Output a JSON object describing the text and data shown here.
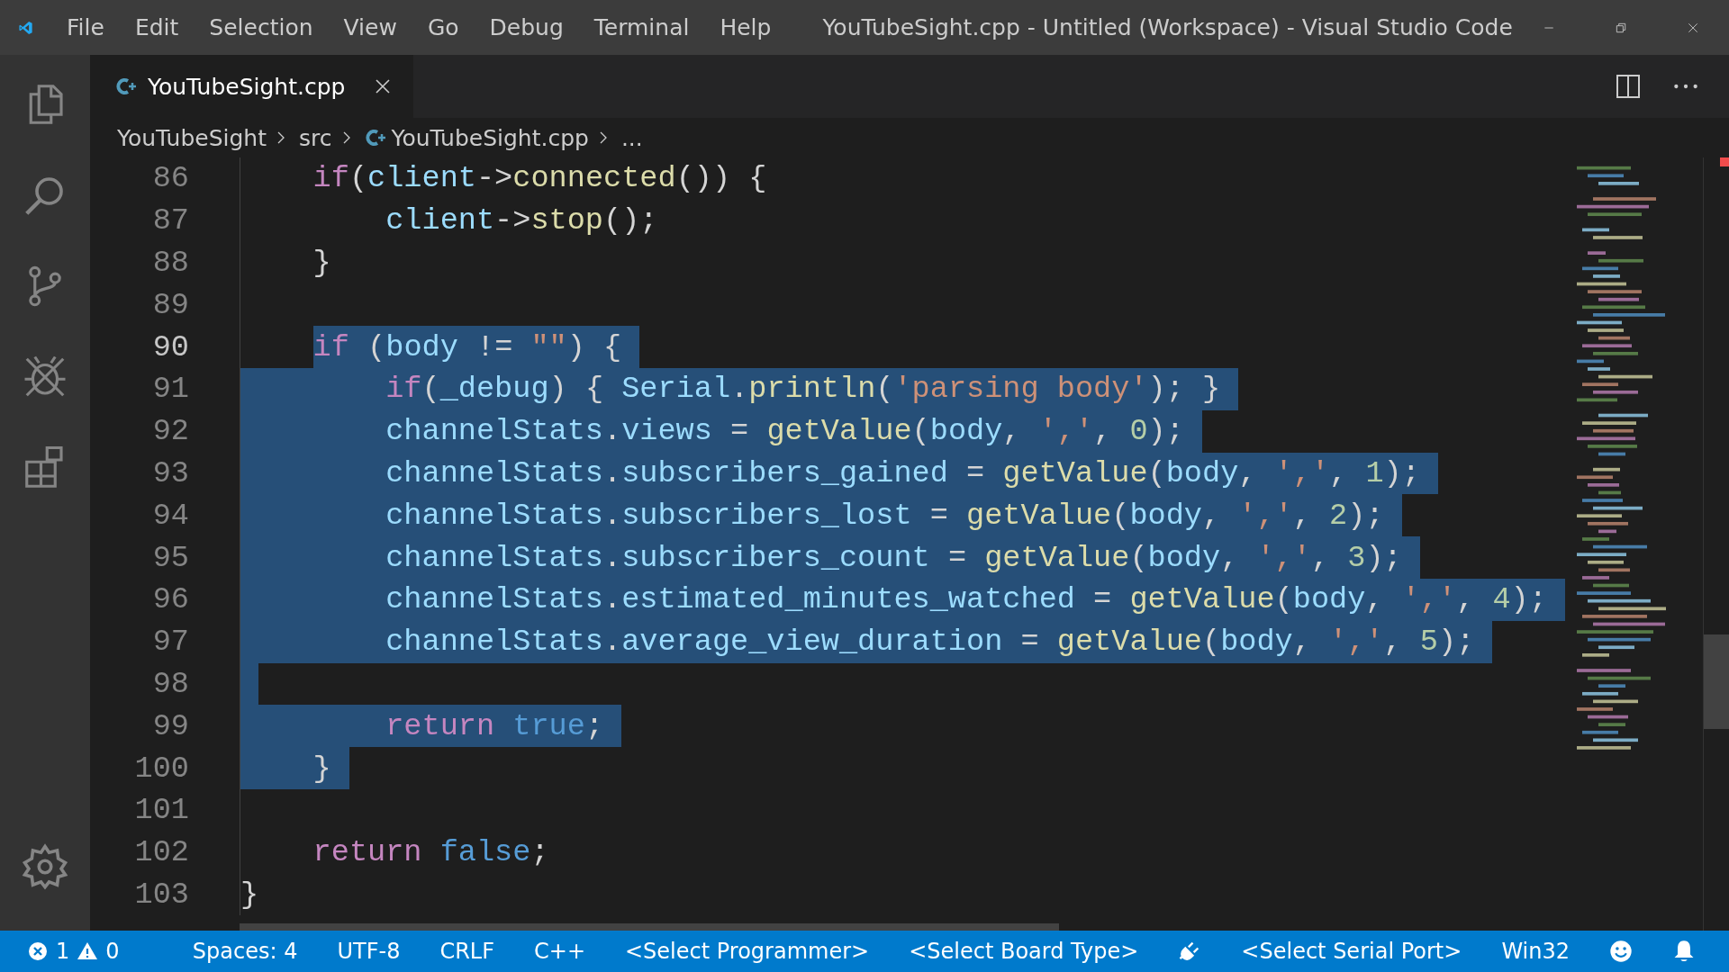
{
  "window": {
    "title": "YouTubeSight.cpp - Untitled (Workspace) - Visual Studio Code"
  },
  "menu": [
    "File",
    "Edit",
    "Selection",
    "View",
    "Go",
    "Debug",
    "Terminal",
    "Help"
  ],
  "activity_bar": [
    {
      "kind": "files"
    },
    {
      "kind": "search"
    },
    {
      "kind": "source-control"
    },
    {
      "kind": "debug"
    },
    {
      "kind": "extensions"
    }
  ],
  "tabs": [
    {
      "label": "YouTubeSight.cpp",
      "selected": true
    }
  ],
  "breadcrumb": [
    {
      "label": "YouTubeSight",
      "kind": "folder"
    },
    {
      "label": "src",
      "kind": "folder"
    },
    {
      "label": "YouTubeSight.cpp",
      "kind": "file"
    },
    {
      "label": "...",
      "kind": "more"
    }
  ],
  "editor": {
    "lines": [
      {
        "number": "86",
        "selected": false,
        "current": false,
        "tokens": [
          {
            "t": "    if",
            "kind": "keyword"
          },
          {
            "t": "(",
            "kind": "plain"
          },
          {
            "t": "client",
            "kind": "variable"
          },
          {
            "t": "->",
            "kind": "plain"
          },
          {
            "t": "connected",
            "kind": "function"
          },
          {
            "t": "()) {",
            "kind": "plain"
          }
        ]
      },
      {
        "number": "87",
        "selected": false,
        "current": false,
        "tokens": [
          {
            "t": "        client",
            "kind": "variable"
          },
          {
            "t": "->",
            "kind": "plain"
          },
          {
            "t": "stop",
            "kind": "function"
          },
          {
            "t": "();",
            "kind": "plain"
          }
        ]
      },
      {
        "number": "88",
        "selected": false,
        "current": false,
        "tokens": [
          {
            "t": "    }",
            "kind": "plain"
          }
        ]
      },
      {
        "number": "89",
        "selected": false,
        "current": false
      },
      {
        "number": "90",
        "selected": true,
        "current": true,
        "tokens": [
          {
            "t": "    if",
            "kind": "keyword"
          },
          {
            "t": " (",
            "kind": "plain"
          },
          {
            "t": "body",
            "kind": "variable"
          },
          {
            "t": " != ",
            "kind": "plain"
          },
          {
            "t": "\"\"",
            "kind": "string"
          },
          {
            "t": ") {",
            "kind": "plain"
          }
        ]
      },
      {
        "number": "91",
        "selected": true,
        "current": false,
        "tokens": [
          {
            "t": "        if",
            "kind": "keyword"
          },
          {
            "t": "(",
            "kind": "plain"
          },
          {
            "t": "_debug",
            "kind": "variable"
          },
          {
            "t": ") { ",
            "kind": "plain"
          },
          {
            "t": "Serial",
            "kind": "variable"
          },
          {
            "t": ".",
            "kind": "plain"
          },
          {
            "t": "println",
            "kind": "function"
          },
          {
            "t": "(",
            "kind": "plain"
          },
          {
            "t": "'parsing body'",
            "kind": "string"
          },
          {
            "t": "); }",
            "kind": "plain"
          }
        ]
      },
      {
        "number": "92",
        "selected": true,
        "current": false,
        "tokens": [
          {
            "t": "        channelStats",
            "kind": "variable"
          },
          {
            "t": ".",
            "kind": "plain"
          },
          {
            "t": "views",
            "kind": "variable"
          },
          {
            "t": " = ",
            "kind": "plain"
          },
          {
            "t": "getValue",
            "kind": "function"
          },
          {
            "t": "(",
            "kind": "plain"
          },
          {
            "t": "body",
            "kind": "variable"
          },
          {
            "t": ", ",
            "kind": "plain"
          },
          {
            "t": "','",
            "kind": "string"
          },
          {
            "t": ", ",
            "kind": "plain"
          },
          {
            "t": "0",
            "kind": "number"
          },
          {
            "t": ");",
            "kind": "plain"
          }
        ]
      },
      {
        "number": "93",
        "selected": true,
        "current": false,
        "tokens": [
          {
            "t": "        channelStats",
            "kind": "variable"
          },
          {
            "t": ".",
            "kind": "plain"
          },
          {
            "t": "subscribers_gained",
            "kind": "variable"
          },
          {
            "t": " = ",
            "kind": "plain"
          },
          {
            "t": "getValue",
            "kind": "function"
          },
          {
            "t": "(",
            "kind": "plain"
          },
          {
            "t": "body",
            "kind": "variable"
          },
          {
            "t": ", ",
            "kind": "plain"
          },
          {
            "t": "','",
            "kind": "string"
          },
          {
            "t": ", ",
            "kind": "plain"
          },
          {
            "t": "1",
            "kind": "number"
          },
          {
            "t": ");",
            "kind": "plain"
          }
        ]
      },
      {
        "number": "94",
        "selected": true,
        "current": false,
        "tokens": [
          {
            "t": "        channelStats",
            "kind": "variable"
          },
          {
            "t": ".",
            "kind": "plain"
          },
          {
            "t": "subscribers_lost",
            "kind": "variable"
          },
          {
            "t": " = ",
            "kind": "plain"
          },
          {
            "t": "getValue",
            "kind": "function"
          },
          {
            "t": "(",
            "kind": "plain"
          },
          {
            "t": "body",
            "kind": "variable"
          },
          {
            "t": ", ",
            "kind": "plain"
          },
          {
            "t": "','",
            "kind": "string"
          },
          {
            "t": ", ",
            "kind": "plain"
          },
          {
            "t": "2",
            "kind": "number"
          },
          {
            "t": ");",
            "kind": "plain"
          }
        ]
      },
      {
        "number": "95",
        "selected": true,
        "current": false,
        "tokens": [
          {
            "t": "        channelStats",
            "kind": "variable"
          },
          {
            "t": ".",
            "kind": "plain"
          },
          {
            "t": "subscribers_count",
            "kind": "variable"
          },
          {
            "t": " = ",
            "kind": "plain"
          },
          {
            "t": "getValue",
            "kind": "function"
          },
          {
            "t": "(",
            "kind": "plain"
          },
          {
            "t": "body",
            "kind": "variable"
          },
          {
            "t": ", ",
            "kind": "plain"
          },
          {
            "t": "','",
            "kind": "string"
          },
          {
            "t": ", ",
            "kind": "plain"
          },
          {
            "t": "3",
            "kind": "number"
          },
          {
            "t": ");",
            "kind": "plain"
          }
        ]
      },
      {
        "number": "96",
        "selected": true,
        "current": false,
        "tokens": [
          {
            "t": "        channelStats",
            "kind": "variable"
          },
          {
            "t": ".",
            "kind": "plain"
          },
          {
            "t": "estimated_minutes_watched",
            "kind": "variable"
          },
          {
            "t": " = ",
            "kind": "plain"
          },
          {
            "t": "getValue",
            "kind": "function"
          },
          {
            "t": "(",
            "kind": "plain"
          },
          {
            "t": "body",
            "kind": "variable"
          },
          {
            "t": ", ",
            "kind": "plain"
          },
          {
            "t": "','",
            "kind": "string"
          },
          {
            "t": ", ",
            "kind": "plain"
          },
          {
            "t": "4",
            "kind": "number"
          },
          {
            "t": ");",
            "kind": "plain"
          }
        ]
      },
      {
        "number": "97",
        "selected": true,
        "current": false,
        "tokens": [
          {
            "t": "        channelStats",
            "kind": "variable"
          },
          {
            "t": ".",
            "kind": "plain"
          },
          {
            "t": "average_view_duration",
            "kind": "variable"
          },
          {
            "t": " = ",
            "kind": "plain"
          },
          {
            "t": "getValue",
            "kind": "function"
          },
          {
            "t": "(",
            "kind": "plain"
          },
          {
            "t": "body",
            "kind": "variable"
          },
          {
            "t": ", ",
            "kind": "plain"
          },
          {
            "t": "','",
            "kind": "string"
          },
          {
            "t": ", ",
            "kind": "plain"
          },
          {
            "t": "5",
            "kind": "number"
          },
          {
            "t": ");",
            "kind": "plain"
          }
        ]
      },
      {
        "number": "98",
        "selected": true,
        "current": false
      },
      {
        "number": "99",
        "selected": true,
        "current": false,
        "tokens": [
          {
            "t": "        return",
            "kind": "keyword"
          },
          {
            "t": " true",
            "kind": "constant"
          },
          {
            "t": ";",
            "kind": "plain"
          }
        ]
      },
      {
        "number": "100",
        "selected": true,
        "current": false,
        "tokens": [
          {
            "t": "    }",
            "kind": "plain"
          }
        ]
      },
      {
        "number": "101",
        "selected": false,
        "current": false
      },
      {
        "number": "102",
        "selected": false,
        "current": false,
        "tokens": [
          {
            "t": "    return",
            "kind": "keyword"
          },
          {
            "t": " false",
            "kind": "constant"
          },
          {
            "t": ";",
            "kind": "plain"
          }
        ]
      },
      {
        "number": "103",
        "selected": false,
        "current": false,
        "tokens": [
          {
            "t": "}",
            "kind": "plain"
          }
        ]
      }
    ]
  },
  "status_bar": {
    "errors": "1",
    "warnings": "0",
    "items": [
      {
        "kind": "text",
        "label": "Spaces: 4"
      },
      {
        "kind": "text",
        "label": "UTF-8"
      },
      {
        "kind": "text",
        "label": "CRLF"
      },
      {
        "kind": "text",
        "label": "C++"
      },
      {
        "kind": "text",
        "label": "<Select Programmer>"
      },
      {
        "kind": "text",
        "label": "<Select Board Type>"
      },
      {
        "kind": "plug"
      },
      {
        "kind": "text",
        "label": "<Select Serial Port>"
      },
      {
        "kind": "text",
        "label": "Win32"
      },
      {
        "kind": "smiley"
      },
      {
        "kind": "bell"
      }
    ]
  }
}
